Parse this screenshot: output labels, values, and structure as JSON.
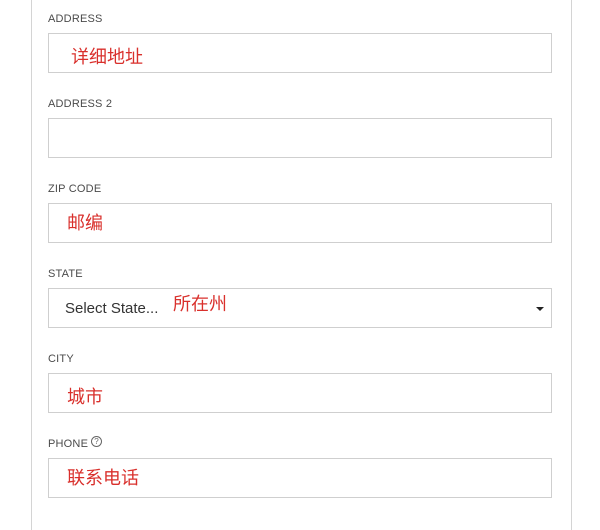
{
  "form": {
    "address": {
      "label": "ADDRESS",
      "value": "",
      "annotation": "详细地址"
    },
    "address2": {
      "label": "ADDRESS 2",
      "value": ""
    },
    "zip": {
      "label": "ZIP CODE",
      "value": "",
      "annotation": "邮编"
    },
    "state": {
      "label": "STATE",
      "selected": "Select State...",
      "annotation": "所在州"
    },
    "city": {
      "label": "CITY",
      "value": "",
      "annotation": "城市"
    },
    "phone": {
      "label": "PHONE",
      "value": "",
      "annotation": "联系电话",
      "help_icon": "?"
    }
  },
  "colors": {
    "annotation": "#d9302c",
    "border": "#cfcfcf"
  }
}
